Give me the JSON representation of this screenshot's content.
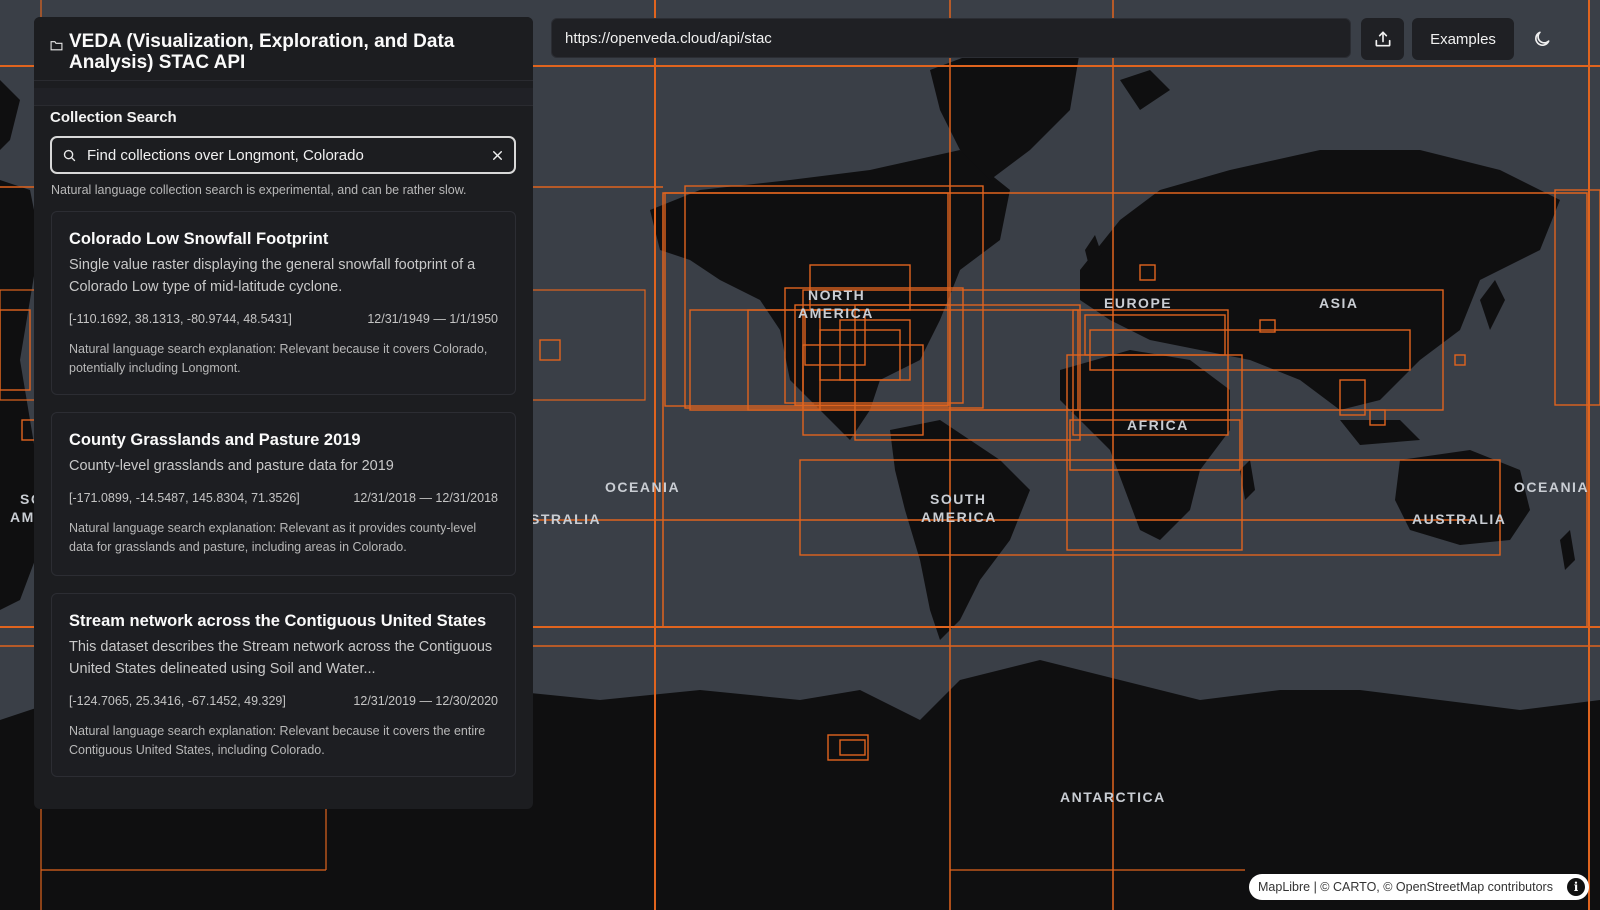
{
  "app": {
    "title": "VEDA (Visualization, Exploration, and Data Analysis) STAC API"
  },
  "topbar": {
    "url": "https://openveda.cloud/api/stac",
    "examples_label": "Examples"
  },
  "search": {
    "section_label": "Collection Search",
    "value": "Find collections over Longmont, Colorado",
    "hint": "Natural language collection search is experimental, and can be rather slow."
  },
  "results": [
    {
      "title": "Colorado Low Snowfall Footprint",
      "description": "Single value raster displaying the general snowfall footprint of a Colorado Low type of mid-latitude cyclone.",
      "bbox": "[-110.1692, 38.1313, -80.9744, 48.5431]",
      "dates": "12/31/1949 — 1/1/1950",
      "explanation": "Natural language search explanation: Relevant because it covers Colorado, potentially including Longmont."
    },
    {
      "title": "County Grasslands and Pasture 2019",
      "description": "County-level grasslands and pasture data for 2019",
      "bbox": "[-171.0899, -14.5487, 145.8304, 71.3526]",
      "dates": "12/31/2018 — 12/31/2018",
      "explanation": "Natural language search explanation: Relevant as it provides county-level data for grasslands and pasture, including areas in Colorado."
    },
    {
      "title": "Stream network across the Contiguous United States",
      "description": "This dataset describes the Stream network across the Contiguous United States delineated using Soil and Water...",
      "bbox": "[-124.7065, 25.3416, -67.1452, 49.329]",
      "dates": "12/31/2019 — 12/30/2020",
      "explanation": "Natural language search explanation: Relevant because it covers the entire Contiguous United States, including Colorado."
    }
  ],
  "map": {
    "labels": {
      "north_america_1": "NORTH",
      "north_america_2": "AMERICA",
      "europe": "EUROPE",
      "asia": "ASIA",
      "africa": "AFRICA",
      "south_america_1": "SOUTH",
      "south_america_2": "AMERICA",
      "oceania_left": "OCEANIA",
      "oceania_right": "OCEANIA",
      "australia_left": "STRALIA",
      "australia_right": "AUSTRALIA",
      "antarctica": "ANTARCTICA",
      "south_america_edge_1": "SO",
      "south_america_edge_2": "AM"
    },
    "attribution": "MapLibre | © CARTO, © OpenStreetMap contributors"
  },
  "colors": {
    "ocean": "#3a3f47",
    "land": "#0f0f10",
    "bbox_outline": "#e0641e",
    "panel": "#1c1d20"
  }
}
